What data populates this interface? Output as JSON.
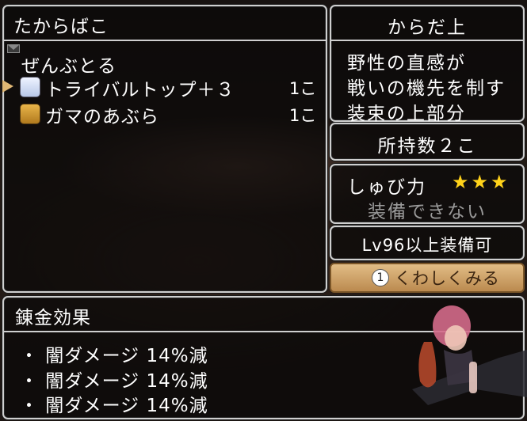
{
  "treasure_window": {
    "title": "たからばこ",
    "take_all": "ぜんぶとる",
    "items": [
      {
        "name": "トライバルトップ＋３",
        "qty": "1こ",
        "icon": "shirt-icon"
      },
      {
        "name": "ガマのあぶら",
        "qty": "1こ",
        "icon": "oil-jar-icon"
      }
    ]
  },
  "info_panel": {
    "category": "からだ上",
    "description": [
      "野性の直感が",
      "戦いの機先を制す",
      "装束の上部分"
    ],
    "owned": "所持数２こ",
    "defense_label": "しゅび力",
    "defense_stars": 3,
    "stars_text": "★★★",
    "equip_status": "装備できない",
    "level_req": "Lv96以上装備可",
    "detail_button": "くわしくみる",
    "detail_button_key": "1"
  },
  "alchemy_window": {
    "title": "錬金効果",
    "effects": [
      "・ 闇ダメージ 14%減",
      "・ 闇ダメージ 14%減",
      "・ 闇ダメージ 14%減"
    ]
  },
  "colors": {
    "window_border": "#cfcfcf",
    "star": "#ffd21a",
    "button": "#e2bd86",
    "cursor": "#e0b774"
  }
}
